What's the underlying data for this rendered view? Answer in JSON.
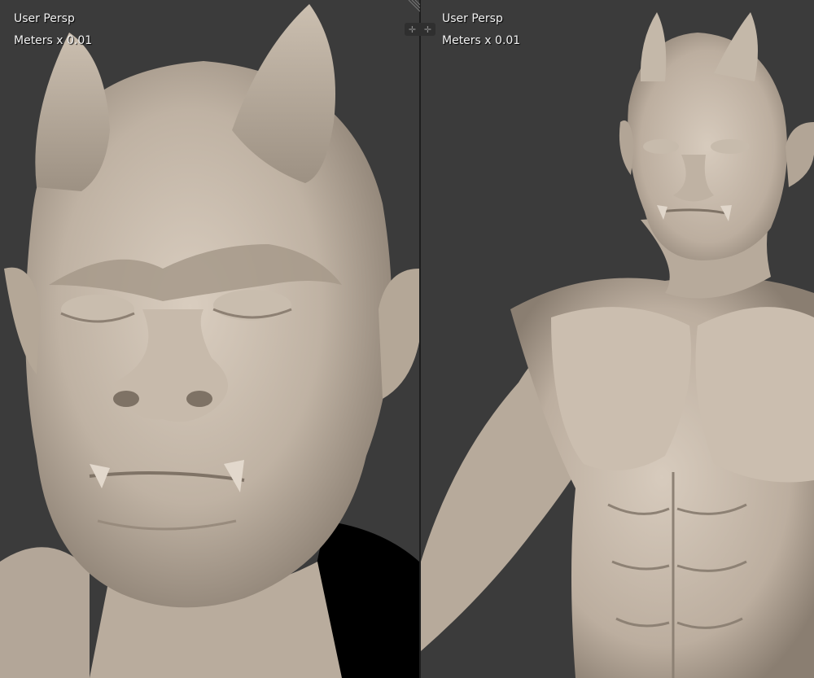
{
  "viewports": [
    {
      "view_name": "User Persp",
      "units": "Meters x 0.01"
    },
    {
      "view_name": "User Persp",
      "units": "Meters x 0.01"
    }
  ],
  "colors": {
    "viewport_bg": "#3b3b3b",
    "clay": "#cfc2b3",
    "clay_shadow": "#8a7d70",
    "divider": "#1e1e1e",
    "overlay_text": "#f2f2f2"
  },
  "icons": {
    "split_left": "plus-icon",
    "split_right": "plus-icon",
    "corner": "area-split-corner-icon"
  }
}
